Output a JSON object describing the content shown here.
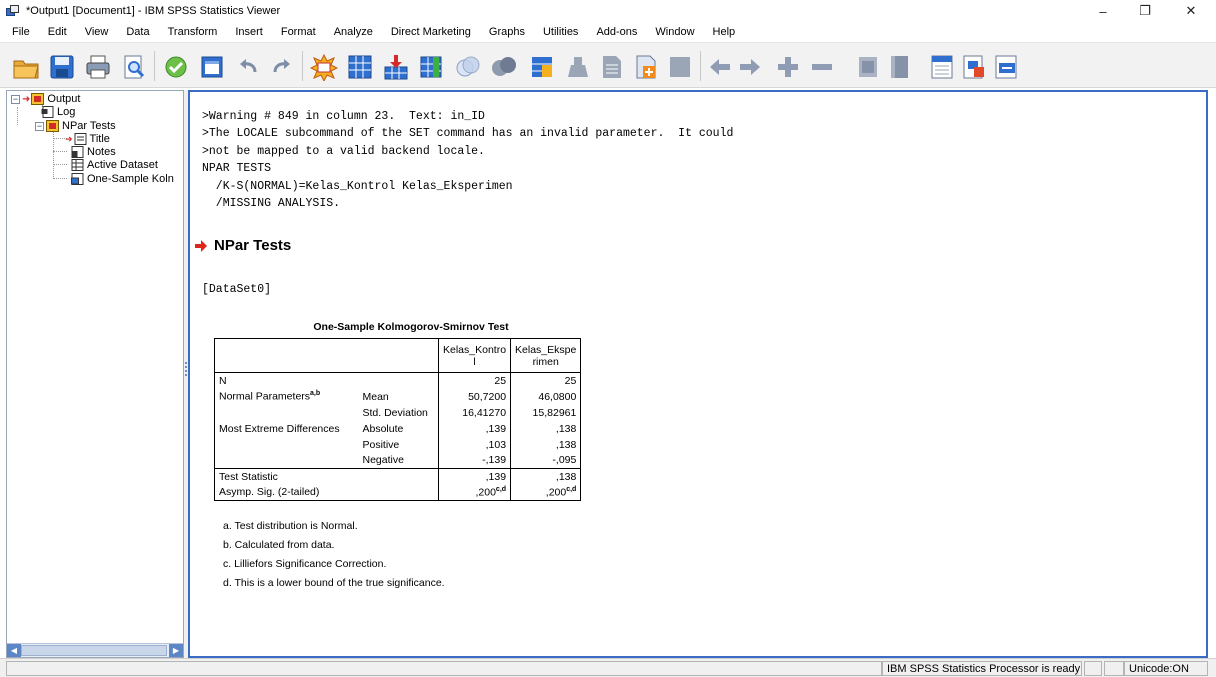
{
  "window": {
    "title": "*Output1 [Document1] - IBM SPSS Statistics Viewer",
    "minimize": "–",
    "maximize": "❐",
    "close": "✕"
  },
  "menu": [
    "File",
    "Edit",
    "View",
    "Data",
    "Transform",
    "Insert",
    "Format",
    "Analyze",
    "Direct Marketing",
    "Graphs",
    "Utilities",
    "Add-ons",
    "Window",
    "Help"
  ],
  "toolbar": {
    "icons": [
      "open-icon",
      "save-icon",
      "print-icon",
      "print-preview-icon",
      "export-icon",
      "recall-dialog-icon",
      "undo-icon",
      "redo-icon",
      "goto-data-icon",
      "goto-variable-icon",
      "insert-case-icon",
      "insert-variable-icon",
      "circle-light-icon",
      "circle-dark-icon",
      "split-file-icon",
      "weight-cases-icon",
      "select-cases-icon",
      "value-labels-icon",
      "use-sets-icon",
      "promote-icon",
      "demote-icon",
      "expand-icon",
      "collapse-icon",
      "show-icon",
      "hide-icon",
      "insert-heading-icon",
      "insert-title-icon",
      "insert-text-icon"
    ]
  },
  "outline": {
    "items": [
      {
        "label": "Output",
        "icon": "output-book-icon"
      },
      {
        "label": "Log",
        "icon": "log-icon"
      },
      {
        "label": "NPar Tests",
        "icon": "section-book-icon"
      },
      {
        "label": "Title",
        "icon": "title-icon"
      },
      {
        "label": "Notes",
        "icon": "notes-icon"
      },
      {
        "label": "Active Dataset",
        "icon": "dataset-icon"
      },
      {
        "label": "One-Sample Koln",
        "icon": "table-icon"
      }
    ]
  },
  "content": {
    "syntax_lines": [
      ">Warning # 849 in column 23.  Text: in_ID",
      ">The LOCALE subcommand of the SET command has an invalid parameter.  It could",
      ">not be mapped to a valid backend locale.",
      "NPAR TESTS",
      "  /K-S(NORMAL)=Kelas_Kontrol Kelas_Eksperimen",
      "  /MISSING ANALYSIS."
    ],
    "section_title": "NPar Tests",
    "dataset_label": "[DataSet0]",
    "table": {
      "title": "One-Sample Kolmogorov-Smirnov Test",
      "col1_header_a": "Kelas_Kontro",
      "col1_header_b": "l",
      "col2_header_a": "Kelas_Ekspe",
      "col2_header_b": "rimen",
      "rows": [
        {
          "label": "N",
          "sub": "",
          "sup": "",
          "v1": "25",
          "v2": "25",
          "v1sup": "",
          "v2sup": ""
        },
        {
          "label": "Normal Parameters",
          "sub": "Mean",
          "sup": "a,b",
          "v1": "50,7200",
          "v2": "46,0800",
          "v1sup": "",
          "v2sup": ""
        },
        {
          "label": "",
          "sub": "Std. Deviation",
          "sup": "",
          "v1": "16,41270",
          "v2": "15,82961",
          "v1sup": "",
          "v2sup": ""
        },
        {
          "label": "Most Extreme Differences",
          "sub": "Absolute",
          "sup": "",
          "v1": ",139",
          "v2": ",138",
          "v1sup": "",
          "v2sup": ""
        },
        {
          "label": "",
          "sub": "Positive",
          "sup": "",
          "v1": ",103",
          "v2": ",138",
          "v1sup": "",
          "v2sup": ""
        },
        {
          "label": "",
          "sub": "Negative",
          "sup": "",
          "v1": "-,139",
          "v2": "-,095",
          "v1sup": "",
          "v2sup": ""
        },
        {
          "label": "Test Statistic",
          "sub": "",
          "sup": "",
          "v1": ",139",
          "v2": ",138",
          "v1sup": "",
          "v2sup": ""
        },
        {
          "label": "Asymp. Sig. (2-tailed)",
          "sub": "",
          "sup": "",
          "v1": ",200",
          "v2": ",200",
          "v1sup": "c,d",
          "v2sup": "c,d"
        }
      ],
      "footnotes": [
        "a. Test distribution is Normal.",
        "b. Calculated from data.",
        "c. Lilliefors Significance Correction.",
        "d. This is a lower bound of the true significance."
      ]
    }
  },
  "statusbar": {
    "processor": "IBM SPSS Statistics Processor is ready",
    "encoding": "Unicode:ON"
  }
}
